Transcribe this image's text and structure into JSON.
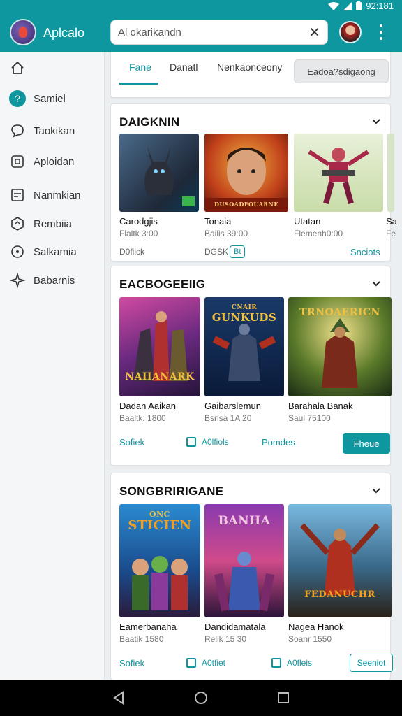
{
  "status": {
    "time": "92:181"
  },
  "appbar": {
    "title": "Aplcalo",
    "search_value": "Al okarikandn",
    "icons": [
      "app-logo",
      "close-icon",
      "user-avatar",
      "more-vert-icon"
    ]
  },
  "sidebar": {
    "items": [
      {
        "label": "",
        "icon": "home-icon"
      },
      {
        "label": "Samiel",
        "icon": "help-icon"
      },
      {
        "label": "Taokikan",
        "icon": "chat-icon"
      },
      {
        "label": "Aploidan",
        "icon": "app-icon"
      },
      {
        "label": "Nanmkian",
        "icon": "list-icon"
      },
      {
        "label": "Rembiia",
        "icon": "hexagon-icon"
      },
      {
        "label": "Salkamia",
        "icon": "info-icon"
      },
      {
        "label": "Babarnis",
        "icon": "star-icon"
      }
    ]
  },
  "tabs": {
    "items": [
      "Fane",
      "Danatl",
      "Nenkaonceony"
    ],
    "filter": "Eadoa?sdigaong"
  },
  "section1": {
    "title": "DAIGKNIN",
    "tiles": [
      {
        "name": "Carodgjis",
        "meta": "Flaltk 3:00"
      },
      {
        "name": "Tonaia",
        "meta": "Bailis 39:00"
      },
      {
        "name": "Utatan",
        "meta": "Flemenh0:00"
      },
      {
        "name": "Sa",
        "meta": "Fe"
      }
    ],
    "footer_left": "D0fiick",
    "footer_mid": "DGSK",
    "footer_tag": "Bt",
    "footer_right": "Snciots",
    "cover_badge": "DUSOADFOUARNE"
  },
  "section2": {
    "title": "EACBOGEEIIG",
    "tiles": [
      {
        "name": "Dadan Aaikan",
        "meta": "Baaltk: 1800",
        "cover": "NAIIANARK"
      },
      {
        "name": "Gaibarslemun",
        "meta": "Bsnsa 1A 20",
        "cover": "GUNKUDS"
      },
      {
        "name": "Barahala Banak",
        "meta": "Saul 75100",
        "cover": "TRNOAERICN"
      }
    ],
    "footer_left": "Sofiek",
    "footer_check": "A0lfiols",
    "footer_mid": "Pomdes",
    "footer_button": "Fheue",
    "cover2_top": "CNAIR"
  },
  "section3": {
    "title": "SONGBRIRIGANE",
    "tiles": [
      {
        "name": "Eamerbanaha",
        "meta": "Baatik 1580",
        "cover": "STICIEN",
        "cover_top": "ONC"
      },
      {
        "name": "Dandidamatala",
        "meta": "Relik 15 30",
        "cover": "BANHA"
      },
      {
        "name": "Nagea Hanok",
        "meta": "Soanr 1550",
        "cover": "FEDANUCHR"
      }
    ],
    "footer_left": "Sofiek",
    "footer_check1": "A0tfiet",
    "footer_check2": "A0fleis",
    "footer_button": "Seeniot"
  },
  "navbar": {
    "icons": [
      "back-icon",
      "home-circle-icon",
      "recents-icon"
    ]
  },
  "colors": {
    "accent": "#0f97a0",
    "background": "#eceff1"
  }
}
